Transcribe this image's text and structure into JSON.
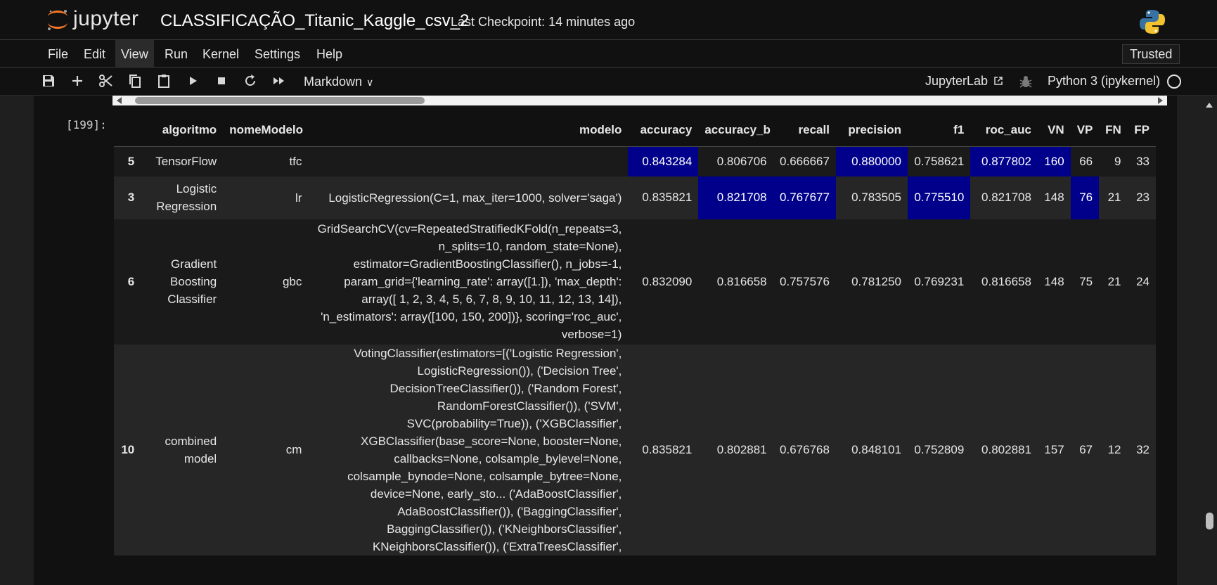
{
  "header": {
    "logo_text": "jupyter",
    "notebook_title": "CLASSIFICAÇÃO_Titanic_Kaggle_csv_2",
    "checkpoint": "Last Checkpoint: 14 minutes ago"
  },
  "menu": {
    "items": [
      "File",
      "Edit",
      "View",
      "Run",
      "Kernel",
      "Settings",
      "Help"
    ],
    "active": "View",
    "trusted_label": "Trusted"
  },
  "toolbar": {
    "icons": [
      "save-icon",
      "add-cell-icon",
      "cut-icon",
      "copy-icon",
      "paste-icon",
      "run-icon",
      "stop-icon",
      "restart-icon",
      "fast-forward-icon"
    ],
    "cell_type": "Markdown",
    "jupyterlab_label": "JupyterLab",
    "kernel_name": "Python 3 (ipykernel)"
  },
  "cell": {
    "prompt": "[199]:"
  },
  "dataframe": {
    "columns": [
      "",
      "algoritmo",
      "nomeModelo",
      "modelo",
      "accuracy",
      "accuracy_b",
      "recall",
      "precision",
      "f1",
      "roc_auc",
      "VN",
      "VP",
      "FN",
      "FP"
    ],
    "highlight_color": "#00008b",
    "rows": [
      {
        "index": "5",
        "algoritmo": "TensorFlow",
        "nomeModelo": "tfc",
        "modelo": "",
        "accuracy": "0.843284",
        "accuracy_b": "0.806706",
        "recall": "0.666667",
        "precision": "0.880000",
        "f1": "0.758621",
        "roc_auc": "0.877802",
        "VN": "160",
        "VP": "66",
        "FN": "9",
        "FP": "33",
        "highlighted": [
          "accuracy",
          "precision",
          "roc_auc",
          "VN"
        ]
      },
      {
        "index": "3",
        "algoritmo": "Logistic\nRegression",
        "nomeModelo": "lr",
        "modelo": "LogisticRegression(C=1, max_iter=1000, solver='saga')",
        "accuracy": "0.835821",
        "accuracy_b": "0.821708",
        "recall": "0.767677",
        "precision": "0.783505",
        "f1": "0.775510",
        "roc_auc": "0.821708",
        "VN": "148",
        "VP": "76",
        "FN": "21",
        "FP": "23",
        "highlighted": [
          "accuracy_b",
          "recall",
          "f1",
          "VP"
        ]
      },
      {
        "index": "6",
        "algoritmo": "Gradient\nBoosting\nClassifier",
        "nomeModelo": "gbc",
        "modelo": "GridSearchCV(cv=RepeatedStratifiedKFold(n_repeats=3,\nn_splits=10, random_state=None),\nestimator=GradientBoostingClassifier(), n_jobs=-1,\nparam_grid={'learning_rate': array([1.]), 'max_depth':\narray([ 1, 2, 3, 4, 5, 6, 7, 8, 9, 10, 11, 12, 13, 14]),\n'n_estimators': array([100, 150, 200])}, scoring='roc_auc',\nverbose=1)",
        "accuracy": "0.832090",
        "accuracy_b": "0.816658",
        "recall": "0.757576",
        "precision": "0.781250",
        "f1": "0.769231",
        "roc_auc": "0.816658",
        "VN": "148",
        "VP": "75",
        "FN": "21",
        "FP": "24",
        "highlighted": []
      },
      {
        "index": "10",
        "algoritmo": "combined\nmodel",
        "nomeModelo": "cm",
        "modelo": "VotingClassifier(estimators=[('Logistic Regression',\nLogisticRegression()), ('Decision Tree',\nDecisionTreeClassifier()), ('Random Forest',\nRandomForestClassifier()), ('SVM',\nSVC(probability=True)), ('XGBClassifier',\nXGBClassifier(base_score=None, booster=None,\ncallbacks=None, colsample_bylevel=None,\ncolsample_bynode=None, colsample_bytree=None,\ndevice=None, early_sto... ('AdaBoostClassifier',\nAdaBoostClassifier()), ('BaggingClassifier',\nBaggingClassifier()), ('KNeighborsClassifier',\nKNeighborsClassifier()), ('ExtraTreesClassifier',",
        "accuracy": "0.835821",
        "accuracy_b": "0.802881",
        "recall": "0.676768",
        "precision": "0.848101",
        "f1": "0.752809",
        "roc_auc": "0.802881",
        "VN": "157",
        "VP": "67",
        "FN": "12",
        "FP": "32",
        "highlighted": []
      }
    ]
  }
}
